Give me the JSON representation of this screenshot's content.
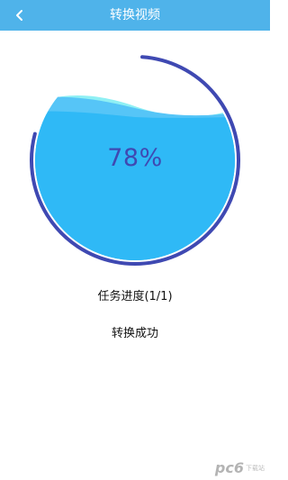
{
  "header": {
    "title": "转换视频",
    "back_icon": "chevron-left-icon"
  },
  "progress": {
    "percent_label": "78%",
    "percent": 78,
    "colors": {
      "ring": "#3f49b2",
      "water": "#2fb9f6",
      "wave_back": "#8ff0f4",
      "wave_mid": "#56c5f7",
      "text": "#3f49b2"
    }
  },
  "task": {
    "progress_label": "任务进度(1/1)"
  },
  "status": {
    "label": "转换成功"
  },
  "watermark": {
    "logo": "pc6",
    "sub": "下载站"
  },
  "colors": {
    "header_bg": "#4fb3ea",
    "header_text": "#ffffff",
    "body_text": "#111111"
  }
}
